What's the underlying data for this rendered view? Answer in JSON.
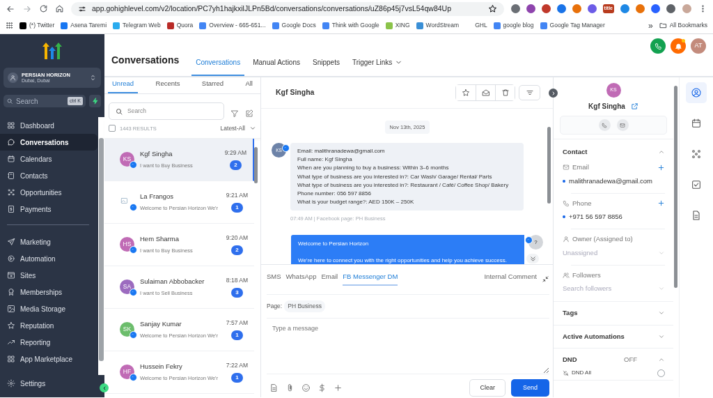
{
  "browser": {
    "url": "app.gohighlevel.com/v2/location/PC7yh1hajkxilJLPn5Bd/conversations/conversations/uZ86p45j7vsL54qw84Up",
    "extensions": [
      {
        "color": "#6b6f75"
      },
      {
        "color": "#8e44ad"
      },
      {
        "color": "#c0392b"
      },
      {
        "color": "#1a73e8"
      },
      {
        "color": "#e8710a"
      },
      {
        "color": "#6c5ce7"
      },
      {
        "label": "title",
        "color": "#b83b1e"
      },
      {
        "color": "#1e88e5"
      },
      {
        "color": "#e8710a"
      },
      {
        "color": "#2962ff"
      },
      {
        "color": "#5f6368"
      }
    ],
    "bookmarks": [
      {
        "label": "(*) Twitter",
        "color": "#000000"
      },
      {
        "label": "Asena Taremi",
        "color": "#1877f2"
      },
      {
        "label": "Telegram Web",
        "color": "#2aabee"
      },
      {
        "label": "Quora",
        "color": "#b92b27"
      },
      {
        "label": "Overview - 665-651...",
        "color": "#4285f4"
      },
      {
        "label": "Google Docs",
        "color": "#4285f4"
      },
      {
        "label": "Think with Google",
        "color": "#4285f4"
      },
      {
        "label": "XING",
        "color": "#8bc34a"
      },
      {
        "label": "WordStream",
        "color": "#3a8fd6"
      },
      {
        "label": "GHL"
      },
      {
        "label": "google blog",
        "color": "#4285f4"
      },
      {
        "label": "Google Tag Manager",
        "color": "#4285f4"
      }
    ],
    "more": "»",
    "all_bookmarks": "All Bookmarks"
  },
  "sidebar": {
    "account": {
      "name": "PERSIAN HORIZON",
      "location": "Dubai, Dubai"
    },
    "search": {
      "placeholder": "Search",
      "shortcut": "ctrl K"
    },
    "groups": [
      {
        "items": [
          {
            "label": "Dashboard",
            "selected": false
          },
          {
            "label": "Conversations",
            "selected": true
          },
          {
            "label": "Calendars",
            "selected": false
          },
          {
            "label": "Contacts",
            "selected": false
          },
          {
            "label": "Opportunities",
            "selected": false
          },
          {
            "label": "Payments",
            "selected": false
          }
        ]
      },
      {
        "items": [
          {
            "label": "Marketing",
            "selected": false
          },
          {
            "label": "Automation",
            "selected": false
          },
          {
            "label": "Sites",
            "selected": false
          },
          {
            "label": "Memberships",
            "selected": false
          },
          {
            "label": "Media Storage",
            "selected": false
          },
          {
            "label": "Reputation",
            "selected": false
          },
          {
            "label": "Reporting",
            "selected": false
          },
          {
            "label": "App Marketplace",
            "selected": false
          }
        ]
      }
    ],
    "settings": "Settings"
  },
  "header": {
    "title": "Conversations",
    "tabs": [
      {
        "label": "Conversations",
        "selected": true,
        "menu": false
      },
      {
        "label": "Manual Actions",
        "selected": false,
        "menu": false
      },
      {
        "label": "Snippets",
        "selected": false,
        "menu": false
      },
      {
        "label": "Trigger Links",
        "selected": false,
        "menu": true
      }
    ],
    "user_initials": "AT",
    "notification": true
  },
  "list": {
    "tabs": [
      {
        "label": "Unread",
        "selected": true
      },
      {
        "label": "Recents",
        "selected": false
      },
      {
        "label": "Starred",
        "selected": false
      },
      {
        "label": "All",
        "selected": false
      }
    ],
    "search": {
      "placeholder": "Search"
    },
    "select_all": false,
    "results": "1443 RESULTS",
    "sort": "Latest-All",
    "conversations": [
      {
        "kind": "initials",
        "initials": "KS",
        "color": "#c06bb5",
        "name": "Kgf Singha",
        "preview": "I want to Buy Business",
        "time": "9:29 AM",
        "unread": "2",
        "selected": true
      },
      {
        "kind": "photo",
        "name": "La Frangos",
        "preview": "Welcome to Persian Horizon We'r",
        "time": "9:21 AM",
        "unread": "1",
        "selected": false
      },
      {
        "kind": "initials",
        "initials": "HS",
        "color": "#c06bb5",
        "name": "Hem Sharma",
        "preview": "I want to Buy Business",
        "time": "9:20 AM",
        "unread": "2",
        "selected": false
      },
      {
        "kind": "initials",
        "initials": "SA",
        "color": "#9c6bbf",
        "name": "Sulaiman Abbobacker",
        "preview": "I want to Sell Business",
        "time": "8:18 AM",
        "unread": "3",
        "selected": false
      },
      {
        "kind": "initials",
        "initials": "SK",
        "color": "#6cbd6c",
        "name": "Sanjay Kumar",
        "preview": "Welcome to Persian Horizon We'r",
        "time": "7:57 AM",
        "unread": "1",
        "selected": false
      },
      {
        "kind": "initials",
        "initials": "HF",
        "color": "#c06bb5",
        "name": "Hussein Fekry",
        "preview": "Welcome to Persian Horizon We'r",
        "time": "7:22 AM",
        "unread": "1",
        "selected": false
      }
    ]
  },
  "chat": {
    "contact": "Kgf Singha",
    "date": "Nov 13th, 2025",
    "messages": [
      {
        "kind": "incoming",
        "initials": "KS",
        "lines": [
          "Email: malithranadewa@gmail.com",
          "Full name: Kgf Singha",
          "When are you planning to buy a business: Within 3–6 months",
          "What type of business are you interested in?: Car Wash/ Garage/ Rental/ Parts",
          "What type of business are you interested in?: Restaurant / Café/ Coffee Shop/ Bakery",
          "Phone number: 056 597 8856",
          "What is your budget range?: AED 150K – 250K"
        ],
        "meta": "07:49 AM | Facebook page: PH Business"
      },
      {
        "kind": "outgoing",
        "initials": "?",
        "lines": [
          "Welcome to Persian Horizon",
          "We’re here to connect you with the right opportunities and help you achieve success."
        ]
      }
    ],
    "composer": {
      "channels": [
        {
          "label": "SMS",
          "selected": false
        },
        {
          "label": "WhatsApp",
          "selected": false
        },
        {
          "label": "Email",
          "selected": false
        },
        {
          "label": "FB Messenger DM",
          "selected": true
        }
      ],
      "internal": "Internal Comment",
      "page_label": "Page:",
      "page": "PH Business",
      "placeholder": "Type a message",
      "clear": "Clear",
      "send": "Send"
    }
  },
  "contact_panel": {
    "initials": "KS",
    "color": "#c06bb5",
    "name": "Kgf Singha",
    "sections": [
      {
        "title": "Contact",
        "expanded": true,
        "fields": [
          {
            "kind": "list",
            "label": "Email",
            "value": "malithranadewa@gmail.com"
          },
          {
            "kind": "list",
            "label": "Phone",
            "value": "+971 56 597 8856"
          },
          {
            "kind": "select",
            "label": "Owner (Assigned to)",
            "placeholder": "Unassigned"
          },
          {
            "kind": "select",
            "label": "Followers",
            "placeholder": "Search followers"
          }
        ]
      },
      {
        "title": "Tags",
        "expanded": false
      },
      {
        "title": "Active Automations",
        "expanded": false
      },
      {
        "title": "DND",
        "status": "OFF",
        "expanded": true,
        "options": [
          {
            "label": "DND All",
            "checked": false
          }
        ]
      }
    ]
  },
  "rail": [
    {
      "selected": true
    },
    {
      "selected": false
    },
    {
      "selected": false
    },
    {
      "selected": false
    },
    {
      "selected": false
    }
  ]
}
